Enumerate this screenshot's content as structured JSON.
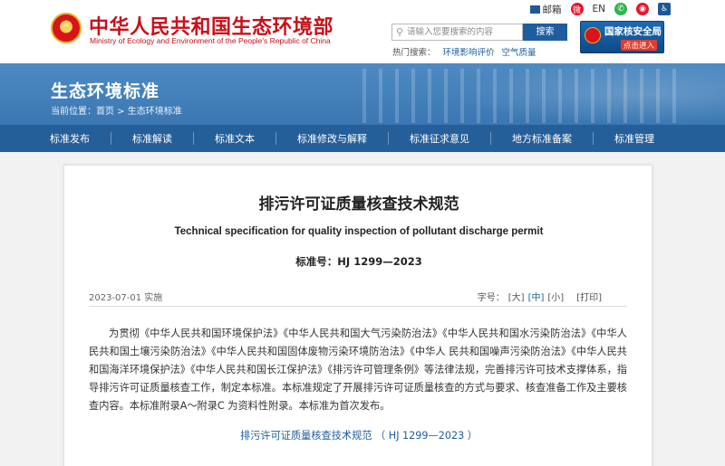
{
  "header": {
    "site_title": "中华人民共和国生态环境部",
    "site_title_en": "Ministry of Ecology and Environment of the People's Republic of China",
    "top_links": {
      "mail": "邮箱",
      "weibo_label": "微博",
      "english": "EN"
    },
    "search": {
      "placeholder": "请输入您要搜索的内容",
      "button": "搜索"
    },
    "hot_search": {
      "label": "热门搜索：",
      "items": [
        "环境影响评价",
        "空气质量"
      ]
    },
    "nsa": {
      "title": "国家核安全局",
      "enter": "点击进入"
    }
  },
  "banner": {
    "title": "生态环境标准",
    "breadcrumb": {
      "prefix": "当前位置：",
      "home": "首页",
      "sep": " > ",
      "current": "生态环境标准"
    }
  },
  "nav": {
    "items": [
      "标准发布",
      "标准解读",
      "标准文本",
      "标准修改与解释",
      "标准征求意见",
      "地方标准备案",
      "标准管理"
    ]
  },
  "article": {
    "title": "排污许可证质量核查技术规范",
    "title_en": "Technical specification for quality inspection of pollutant discharge permit",
    "standard_no": "标准号：HJ 1299—2023",
    "meta": "2023-07-01 实施",
    "font_size": {
      "label": "字号：",
      "large": "[大]",
      "medium": "[中]",
      "small": "[小]",
      "print": "[打印]"
    },
    "body": "为贯彻《中华人民共和国环境保护法》《中华人民共和国大气污染防治法》《中华人民共和国水污染防治法》《中华人民共和国土壤污染防治法》《中华人民共和国固体废物污染环境防治法》《中华人 民共和国噪声污染防治法》《中华人民共和国海洋环境保护法》《中华人民共和国长江保护法》《排污许可管理条例》等法律法规，完善排污许可技术支撑体系，指导排污许可证质量核查工作，制定本标准。本标准规定了开展排污许可证质量核查的方式与要求、核查准备工作及主要核查内容。本标准附录A～附录C 为资料性附录。本标准为首次发布。",
    "doc_link": "排污许可证质量核查技术规范 （ HJ 1299—2023 ）"
  }
}
